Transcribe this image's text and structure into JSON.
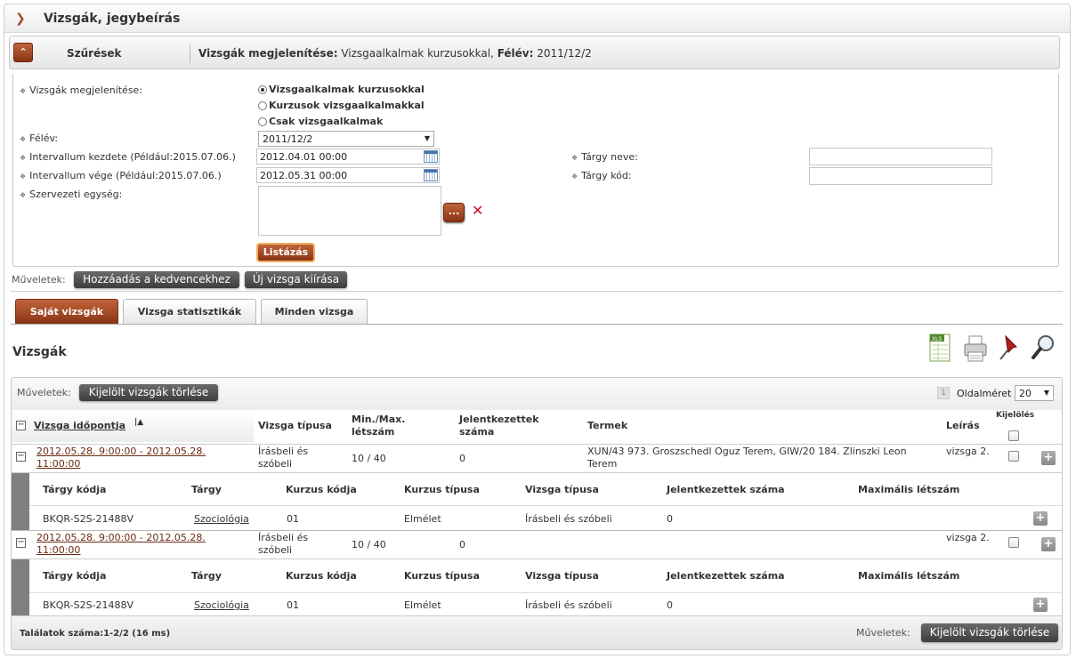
{
  "header": {
    "title": "Vizsgák, jegybeírás"
  },
  "filters": {
    "toggle_icon": "double-chevron-up-icon",
    "label": "Szűrések",
    "summary_prefix": "Vizsgák megjelenítése:",
    "summary_value": "Vizsgaalkalmak kurzusokkal,",
    "summary_sem_label": "Félév:",
    "summary_sem_value": "2011/12/2",
    "display_label": "Vizsgák megjelenítése:",
    "radio_options": [
      "Vizsgaalkalmak kurzusokkal",
      "Kurzusok vizsgaalkalmakkal",
      "Csak vizsgaalkalmak"
    ],
    "selected_radio": 0,
    "semester_label": "Félév:",
    "semester_value": "2011/12/2",
    "start_label": "Intervallum kezdete (Például:2015.07.06.)",
    "start_value": "2012.04.01 00:00",
    "end_label": "Intervallum vége (Például:2015.07.06.)",
    "end_value": "2012.05.31 00:00",
    "org_label": "Szervezeti egység:",
    "subject_name_label": "Tárgy neve:",
    "subject_code_label": "Tárgy kód:",
    "org_button": "...",
    "list_button": "Listázás"
  },
  "actions": {
    "label": "Műveletek:",
    "favorites": "Hozzáadás a kedvencekhez",
    "new_exam": "Új vizsga kiírása"
  },
  "tabs": [
    "Saját vizsgák",
    "Vizsga statisztikák",
    "Minden vizsga"
  ],
  "section_title": "Vizsgák",
  "toolbar_icons": [
    "xls-export-icon",
    "print-icon",
    "pin-icon",
    "search-zoom-icon"
  ],
  "grid": {
    "actions_label": "Műveletek:",
    "delete_selected": "Kijelölt vizsgák törlése",
    "page_number": "1",
    "page_size_label": "Oldalméret",
    "page_size_value": "20",
    "columns": {
      "datetime": "Vizsga időpontja",
      "type": "Vizsga típusa",
      "minmax": "Min./Max. létszám",
      "applied": "Jelentkezettek száma",
      "rooms": "Termek",
      "desc": "Leírás",
      "select": "Kijelölés"
    },
    "rows": [
      {
        "datetime": "2012.05.28. 9:00:00 - 2012.05.28. 11:00:00",
        "type": "Írásbeli és szóbeli",
        "minmax": "10 / 40",
        "applied": "0",
        "rooms": "XUN/43 973. Groszschedl Oguz Terem, GIW/20 184. Zlinszki Leon Terem",
        "desc": "vizsga 2."
      },
      {
        "datetime": "2012.05.28. 9:00:00 - 2012.05.28. 11:00:00",
        "type": "Írásbeli és szóbeli",
        "minmax": "10 / 40",
        "applied": "0",
        "rooms": "",
        "desc": "vizsga 2."
      }
    ],
    "sub_columns": {
      "code": "Tárgy kódja",
      "subject": "Tárgy",
      "course_code": "Kurzus kódja",
      "course_type": "Kurzus típusa",
      "exam_type": "Vizsga típusa",
      "applied": "Jelentkezettek száma",
      "max": "Maximális létszám"
    },
    "sub_rows": [
      {
        "code": "BKQR-S2S-21488V",
        "subject": "Szociológia",
        "course_code": "01",
        "course_type": "Elmélet",
        "exam_type": "Írásbeli és szóbeli",
        "applied": "0",
        "max": ""
      },
      {
        "code": "BKQR-S2S-21488V",
        "subject": "Szociológia",
        "course_code": "01",
        "course_type": "Elmélet",
        "exam_type": "Írásbeli és szóbeli",
        "applied": "0",
        "max": ""
      }
    ],
    "footer_results": "Találatok száma:1-2/2 (16 ms)",
    "footer_actions_label": "Műveletek:",
    "footer_delete": "Kijelölt vizsgák törlése"
  },
  "colors": {
    "accent": "#8a3416",
    "dark_button": "#4a4a4a"
  }
}
